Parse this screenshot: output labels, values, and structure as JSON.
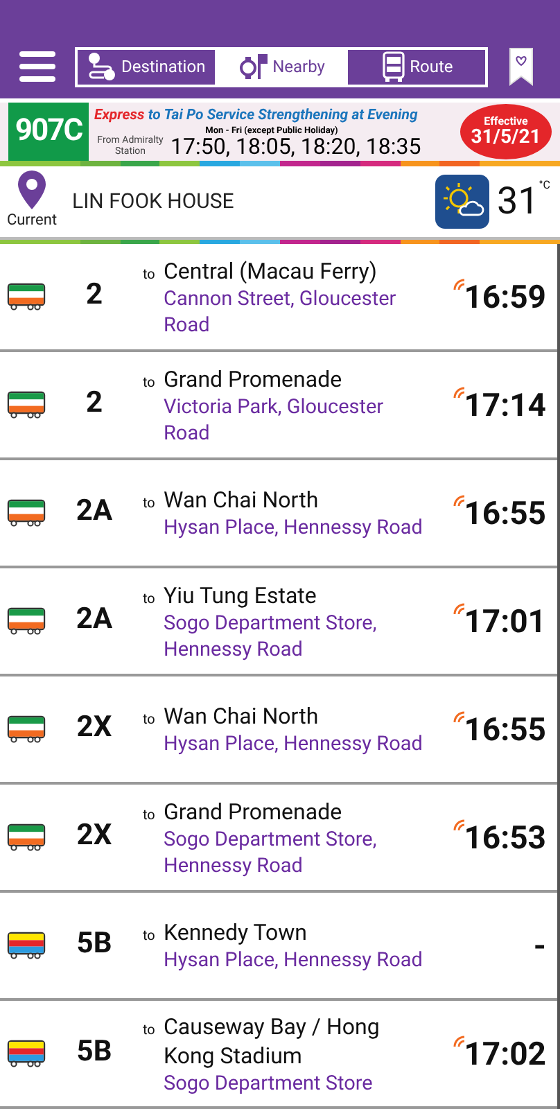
{
  "tabs": [
    {
      "label": "Destination",
      "selected": false
    },
    {
      "label": "Nearby",
      "selected": true
    },
    {
      "label": "Route",
      "selected": false
    }
  ],
  "banner": {
    "route": "907C",
    "headline_1": "Express",
    "headline_2": "to Tai Po",
    "headline_3": "Service Strengthening at Evening",
    "days": "Mon - Fri (except Public Holiday)",
    "origin": "From Admiralty Station",
    "times": "17:50, 18:05, 18:20, 18:35",
    "effective_label": "Effective",
    "effective_date": "31/5/21"
  },
  "location": {
    "caption": "Current",
    "name": "LIN FOOK HOUSE",
    "temperature": "31",
    "unit": "°C"
  },
  "arrivals": [
    {
      "kind": "green",
      "route": "2",
      "to": "to",
      "destination": "Central (Macau Ferry)",
      "stop": "Cannon Street, Gloucester Road",
      "time": "16:59",
      "live": true
    },
    {
      "kind": "green",
      "route": "2",
      "to": "to",
      "destination": "Grand Promenade",
      "stop": "Victoria Park, Gloucester Road",
      "time": "17:14",
      "live": true
    },
    {
      "kind": "green",
      "route": "2A",
      "to": "to",
      "destination": "Wan Chai North",
      "stop": "Hysan Place, Hennessy Road",
      "time": "16:55",
      "live": true
    },
    {
      "kind": "green",
      "route": "2A",
      "to": "to",
      "destination": "Yiu Tung Estate",
      "stop": "Sogo Department Store, Hennessy Road",
      "time": "17:01",
      "live": true
    },
    {
      "kind": "green",
      "route": "2X",
      "to": "to",
      "destination": "Wan Chai North",
      "stop": "Hysan Place, Hennessy Road",
      "time": "16:55",
      "live": true
    },
    {
      "kind": "green",
      "route": "2X",
      "to": "to",
      "destination": "Grand Promenade",
      "stop": "Sogo Department Store, Hennessy Road",
      "time": "16:53",
      "live": true
    },
    {
      "kind": "yellow",
      "route": "5B",
      "to": "to",
      "destination": "Kennedy Town",
      "stop": "Hysan Place, Hennessy Road",
      "time": "-",
      "live": false
    },
    {
      "kind": "yellow",
      "route": "5B",
      "to": "to",
      "destination": "Causeway Bay / Hong Kong Stadium",
      "stop": "Sogo Department Store",
      "time": "17:02",
      "live": true
    }
  ]
}
